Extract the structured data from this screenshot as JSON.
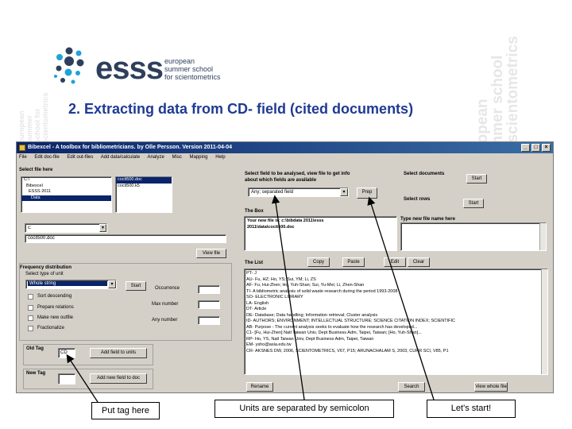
{
  "logo": {
    "name": "esss",
    "subtitle_lines": [
      "european",
      "summer school",
      "for scientometrics"
    ]
  },
  "slide": {
    "title": "2. Extracting data from CD- field (cited documents)"
  },
  "window": {
    "title": "Bibexcel - A toolbox for bibliometricians. by Olle Persson. Version 2011-04-04",
    "controls": [
      "_",
      "□",
      "×"
    ],
    "menus": [
      "File",
      "Edit doc-file",
      "Edit out-files",
      "Add data/calculate",
      "Analyze",
      "Misc",
      "Mapping",
      "Help"
    ]
  },
  "left": {
    "select_file_label": "Select file here",
    "drives": [
      "C:\\",
      "Bibexcel",
      "ESSS 2011",
      "Data"
    ],
    "files": [
      "cocit500.doc",
      "cocit500.k5"
    ],
    "drive_select": "c:",
    "filename_value": "cocit500.doc",
    "viewfile_button": "View file",
    "freq_label": "Frequency distribution",
    "unit_label": "Select type of unit",
    "unit_value": "Whole string",
    "start_button": "Start",
    "sort_desc": "Sort descending",
    "prepare_relations": "Prepare relations",
    "new_outfile": "Make new outfile",
    "fractionalize": "Fractionalize",
    "occurrence_label": "Occurrence",
    "max_number_label": "Max number",
    "any_number_label": "Any number",
    "old_tag_label": "Old Tag",
    "old_tag_value": "CD",
    "add_units_button": "Add field to units",
    "new_tag_label": "New Tag",
    "add_new_tag_button": "Add new field to doc"
  },
  "middle": {
    "field_label_1": "Select field to be analysed, view file to get info",
    "field_label_2": "about which fields are available",
    "field_select_value": "Any; separated field",
    "prep_button": "Prep",
    "thebox_label": "The Box",
    "thebox_line_1": "Your new file is: c:\\bibdata 2011\\esss",
    "thebox_line_2": "2011\\data\\cocit500.doc",
    "thelist_label": "The List",
    "copy_button": "Copy",
    "paste_button": "Paste",
    "edit_button": "Edit",
    "clear_button": "Clear",
    "list_lines": [
      "PT- J",
      "AU- Fu, HZ; Ho, YS; Sui, YM; Li, ZS",
      "AF- Fu, Hui-Zhen; Ho, Yuh-Shan; Sui, Yu-Mei; Li, Zhen-Shan",
      "TI- A bibliometric analysis of solid waste research during the period 1993-2008",
      "SO- ELECTRONIC LIBRARY",
      "LA- English",
      "DT- Article",
      "DE- Database; Data handling; Information retrieval; Cluster analysis",
      "ID- AUTHORS; ENVIRONMENT; INTELLECTUAL STRUCTURE; SCIENCE CITATION INDEX; SCIENTIFIC",
      "AB- Purpose - The current analysis seeks to evaluate how the research has developed...",
      "C1- [Fu, Hui-Zhen] Natl Taiwan Univ, Dept Business Adm, Taipei, Taiwan; [Ho, Yuh-Shan]...",
      "RP- Ho, YS, Natl Taiwan Univ, Dept Business Adm, Taipei, Taiwan",
      "EM- ysho@asia.edu.tw",
      "CR- AKSNES DW, 2006, SCIENTOMETRICS, V67, P15; ARUNACHALAM S, 2003, CURR SCI, V85, P1"
    ],
    "rename_button": "Rename"
  },
  "right": {
    "select_docs_label": "Select documents",
    "start_button_1": "Start",
    "select_rows_label": "Select rows",
    "start_button_2": "Start",
    "type_name_label": "Type new file name here",
    "search_button": "Search",
    "view_button": "View whole file"
  },
  "captions": {
    "tag": "Put tag here",
    "units": "Units are separated by semicolon",
    "start": "Let's start!"
  },
  "watermarks": {
    "left_vertical": "european summer school for scientometrics",
    "right_vertical_1": "european",
    "right_vertical_2": "summer school",
    "right_vertical_3": "for scientometrics"
  },
  "colors": {
    "title_blue": "#1f3a93",
    "logo_navy": "#2e3f5c",
    "logo_cyan": "#1fa3d6",
    "titlebar": "#0a246a"
  }
}
